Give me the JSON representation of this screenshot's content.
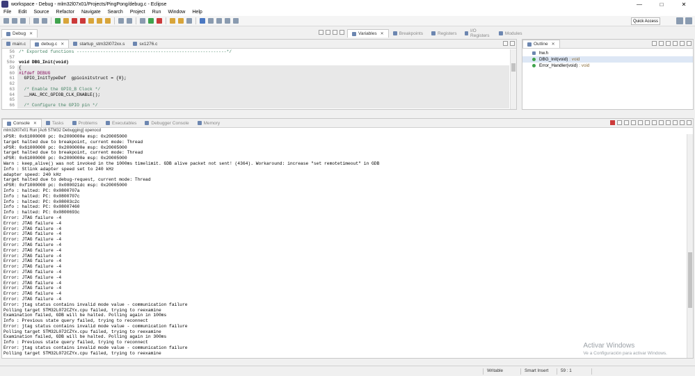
{
  "window": {
    "title": "workspace - Debug - mlm32l07x01/Projects/PingPong/debug.c - Eclipse",
    "controls": [
      "—",
      "□",
      "✕"
    ]
  },
  "menu": [
    "File",
    "Edit",
    "Source",
    "Refactor",
    "Navigate",
    "Search",
    "Project",
    "Run",
    "Window",
    "Help"
  ],
  "toolbar": {
    "quick_access": "Quick Access"
  },
  "debug_view": {
    "label": "Debug"
  },
  "right_tabs": [
    "Variables",
    "Breakpoints",
    "Registers",
    "I/O Registers",
    "Modules"
  ],
  "editor": {
    "tabs": [
      {
        "label": "main.c",
        "active": false
      },
      {
        "label": "debug.c",
        "active": true
      },
      {
        "label": "startup_stm32l072xx.s",
        "active": false
      },
      {
        "label": "sx1276.c",
        "active": false
      }
    ],
    "lines": [
      {
        "n": "56",
        "text": "/* Exported functions ---------------------------------------------------------*/",
        "kind": "cm",
        "hl": false
      },
      {
        "n": "57",
        "text": "",
        "kind": "",
        "hl": false
      },
      {
        "n": "58⊖",
        "text": "void DBG_Init(void)",
        "kind": "fn",
        "hl": false
      },
      {
        "n": "59",
        "text": "{",
        "kind": "",
        "hl": true
      },
      {
        "n": "60",
        "text": "#ifdef DEBUG",
        "kind": "pp",
        "hl": true
      },
      {
        "n": "61",
        "text": "  GPIO_InitTypeDef  gpioinitstruct = {0};",
        "kind": "",
        "hl": true
      },
      {
        "n": "62",
        "text": "",
        "kind": "",
        "hl": true
      },
      {
        "n": "63",
        "text": "  /* Enable the GPIO_B Clock */",
        "kind": "cm",
        "hl": true
      },
      {
        "n": "64",
        "text": "  __HAL_RCC_GPIOB_CLK_ENABLE();",
        "kind": "",
        "hl": true
      },
      {
        "n": "65",
        "text": "",
        "kind": "",
        "hl": true
      },
      {
        "n": "66",
        "text": "  /* Configure the GPIO pin */",
        "kind": "cm",
        "hl": true
      }
    ]
  },
  "outline": {
    "label": "Outline",
    "items": [
      {
        "name": "hw.h",
        "type": "",
        "icon": "header-file-icon",
        "selected": false
      },
      {
        "name": "DBG_Init(void)",
        "type": ": void",
        "icon": "function-icon",
        "selected": true
      },
      {
        "name": "Error_Handler(void)",
        "type": ": void",
        "icon": "function-icon",
        "selected": false
      }
    ]
  },
  "bottom_tabs": [
    "Console",
    "Tasks",
    "Problems",
    "Executables",
    "Debugger Console",
    "Memory"
  ],
  "console": {
    "header": "mlm32l07x01 Run [Ac6 STM32 Debugging] openocd",
    "lines": [
      "xPSR: 0x61000000 pc: 0x2000000e msp: 0x20005000",
      "target halted due to breakpoint, current mode: Thread",
      "xPSR: 0x61000000 pc: 0x2000000e msp: 0x20005000",
      "target halted due to breakpoint, current mode: Thread",
      "xPSR: 0x61000000 pc: 0x2000000e msp: 0x20005000",
      "Warn : keep_alive() was not invoked in the 1000ms timelimit. GDB alive packet not sent! (4364). Workaround: increase \"set remotetimeout\" in GDB",
      "Info : Stlink adapter speed set to 240 kHz",
      "adapter speed: 240 kHz",
      "target halted due to debug-request, current mode: Thread",
      "xPSR: 0xf1000000 pc: 0x080021dc msp: 0x20005000",
      "Info : halted: PC: 0x0800707a",
      "Info : halted: PC: 0x0800707c",
      "Info : halted: PC: 0x08003c2c",
      "Info : halted: PC: 0x08007460",
      "Info : halted: PC: 0x0800693c",
      "Error: JTAG failure -4",
      "Error: JTAG failure -4",
      "Error: JTAG failure -4",
      "Error: JTAG failure -4",
      "Error: JTAG failure -4",
      "Error: JTAG failure -4",
      "Error: JTAG failure -4",
      "Error: JTAG failure -4",
      "Error: JTAG failure -4",
      "Error: JTAG failure -4",
      "Error: JTAG failure -4",
      "Error: JTAG failure -4",
      "Error: JTAG failure -4",
      "Error: JTAG failure -4",
      "Error: JTAG failure -4",
      "Error: JTAG failure -4",
      "Error: jtag status contains invalid mode value - communication failure",
      "Polling target STM32L072CZYx.cpu failed, trying to reexamine",
      "Examination failed, GDB will be halted. Polling again in 100ms",
      "Info : Previous state query failed, trying to reconnect",
      "Error: jtag status contains invalid mode value - communication failure",
      "Polling target STM32L072CZYx.cpu failed, trying to reexamine",
      "Examination failed, GDB will be halted. Polling again in 300ms",
      "Info : Previous state query failed, trying to reconnect",
      "Error: jtag status contains invalid mode value - communication failure",
      "Polling target STM32L072CZYx.cpu failed, trying to reexamine"
    ]
  },
  "watermark": {
    "title": "Activar Windows",
    "subtitle": "Ve a Configuración para activar Windows."
  },
  "status": {
    "mode": "Writable",
    "insert": "Smart Insert",
    "position": "59 : 1"
  }
}
